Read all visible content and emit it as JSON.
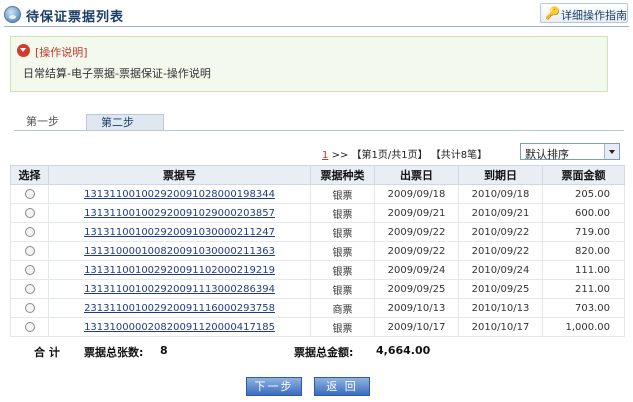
{
  "page": {
    "title": "待保证票据列表",
    "guide_button": "详细操作指南"
  },
  "notice": {
    "title": "[操作说明]",
    "text": "日常结算-电子票据-票据保证-操作说明"
  },
  "tabs": [
    {
      "label": "第一步"
    },
    {
      "label": "第二步"
    }
  ],
  "pager": {
    "current_link": "1",
    "arrows": ">>",
    "page_info": "【第1页/共1页】",
    "total_info": "【共计8笔】"
  },
  "sort": {
    "selected": "默认排序"
  },
  "table": {
    "headers": [
      "选择",
      "票据号",
      "票据种类",
      "出票日",
      "到期日",
      "票面金额"
    ],
    "rows": [
      {
        "no": "131311001002920091028000198344",
        "type": "银票",
        "issue": "2009/09/18",
        "due": "2010/09/18",
        "amount": "205.00"
      },
      {
        "no": "131311001002920091029000203857",
        "type": "银票",
        "issue": "2009/09/21",
        "due": "2010/09/21",
        "amount": "600.00"
      },
      {
        "no": "131311001002920091030000211247",
        "type": "银票",
        "issue": "2009/09/22",
        "due": "2010/09/22",
        "amount": "719.00"
      },
      {
        "no": "131310000100820091030000211363",
        "type": "银票",
        "issue": "2009/09/22",
        "due": "2010/09/22",
        "amount": "820.00"
      },
      {
        "no": "131311001002920091102000219219",
        "type": "银票",
        "issue": "2009/09/24",
        "due": "2010/09/24",
        "amount": "111.00"
      },
      {
        "no": "131311001002920091113000286394",
        "type": "银票",
        "issue": "2009/09/25",
        "due": "2010/09/25",
        "amount": "211.00"
      },
      {
        "no": "231311001002920091116000293758",
        "type": "商票",
        "issue": "2009/10/13",
        "due": "2010/10/13",
        "amount": "703.00"
      },
      {
        "no": "131310000020820091120000417185",
        "type": "银票",
        "issue": "2009/10/17",
        "due": "2010/10/17",
        "amount": "1,000.00"
      }
    ]
  },
  "summary": {
    "total_label": "合 计",
    "count_label": "票据总张数:",
    "count": "8",
    "amount_label": "票据总金额:",
    "amount": "4,664.00"
  },
  "buttons": {
    "next": "下一步",
    "back": "返 回"
  },
  "colors": {
    "accent": "#1a3e66",
    "notice_bg": "#f3f9ec",
    "warn": "#c0392b",
    "button": "#3b6cbf"
  }
}
